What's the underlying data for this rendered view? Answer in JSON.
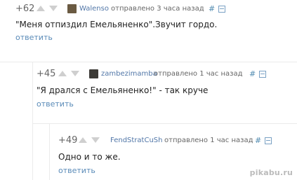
{
  "comments": [
    {
      "rating": "+62",
      "username": "Walenso",
      "sent": "отправлено 3 часа назад",
      "hash": "#",
      "text": "\"Меня отпиздил Емельяненко\".Звучит гордо.",
      "reply": "ответить",
      "avatar_color": "#6a5a42"
    },
    {
      "rating": "+45",
      "username": "zambezimamba",
      "sent": "отправлено 1 час назад",
      "hash": "#",
      "text": "\"Я дрался с Емельяненко!\" - так круче",
      "reply": "ответить",
      "avatar_color": "#3c3a36"
    },
    {
      "rating": "+49",
      "username": "FendStratCuSh",
      "sent": "отправлено 1 час назад",
      "hash": "#",
      "text": "Одно и то же.",
      "reply": "ответить",
      "avatar_color": "#ffffff"
    }
  ],
  "watermark": "pikabu.ru",
  "colors": {
    "username": "#5277a8",
    "link": "#5a8bb8",
    "arrow": "#cfcfcf"
  }
}
